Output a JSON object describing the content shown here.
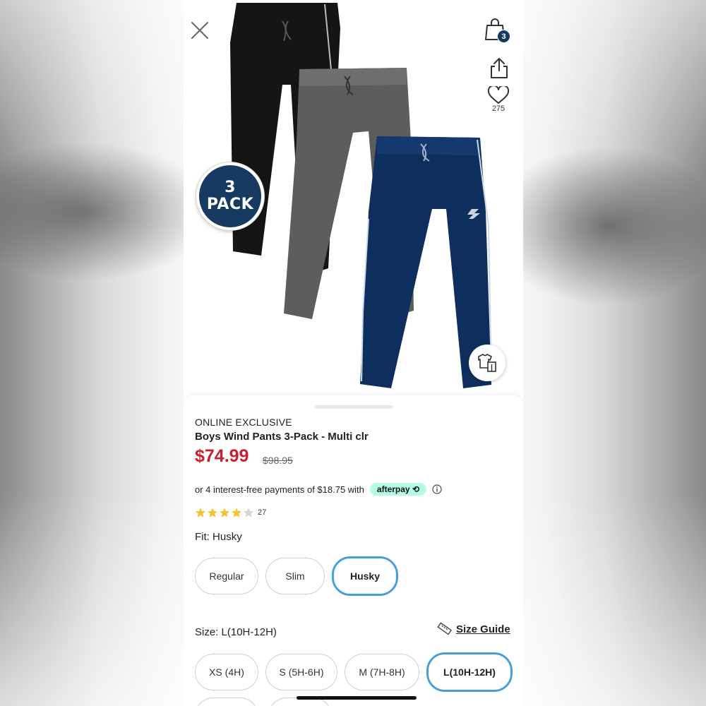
{
  "header": {
    "cart_count": "3",
    "favorites_count": "275"
  },
  "hero": {
    "badge_line1": "3",
    "badge_line2": "PACK"
  },
  "product": {
    "tag": "ONLINE EXCLUSIVE",
    "title": "Boys Wind Pants 3-Pack - Multi clr",
    "price": "$74.99",
    "original_price": "$98.95",
    "afterpay_text": "or 4 interest-free payments of $18.75 with",
    "afterpay_brand": "afterpay",
    "rating": 4,
    "rating_max": 5,
    "review_count": "27"
  },
  "fit": {
    "label": "Fit:",
    "selected": "Husky",
    "options": [
      "Regular",
      "Slim",
      "Husky"
    ]
  },
  "size": {
    "label": "Size:",
    "selected": "L(10H-12H)",
    "guide_label": "Size Guide",
    "options": [
      "XS (4H)",
      "S (5H-6H)",
      "M (7H-8H)",
      "L(10H-12H)"
    ]
  },
  "colors": {
    "price_red": "#c8202d",
    "brand_navy": "#173a63",
    "selected_border": "#4a9fd8",
    "afterpay_mint": "#b2fce4",
    "star_gold": "#f4c430"
  }
}
